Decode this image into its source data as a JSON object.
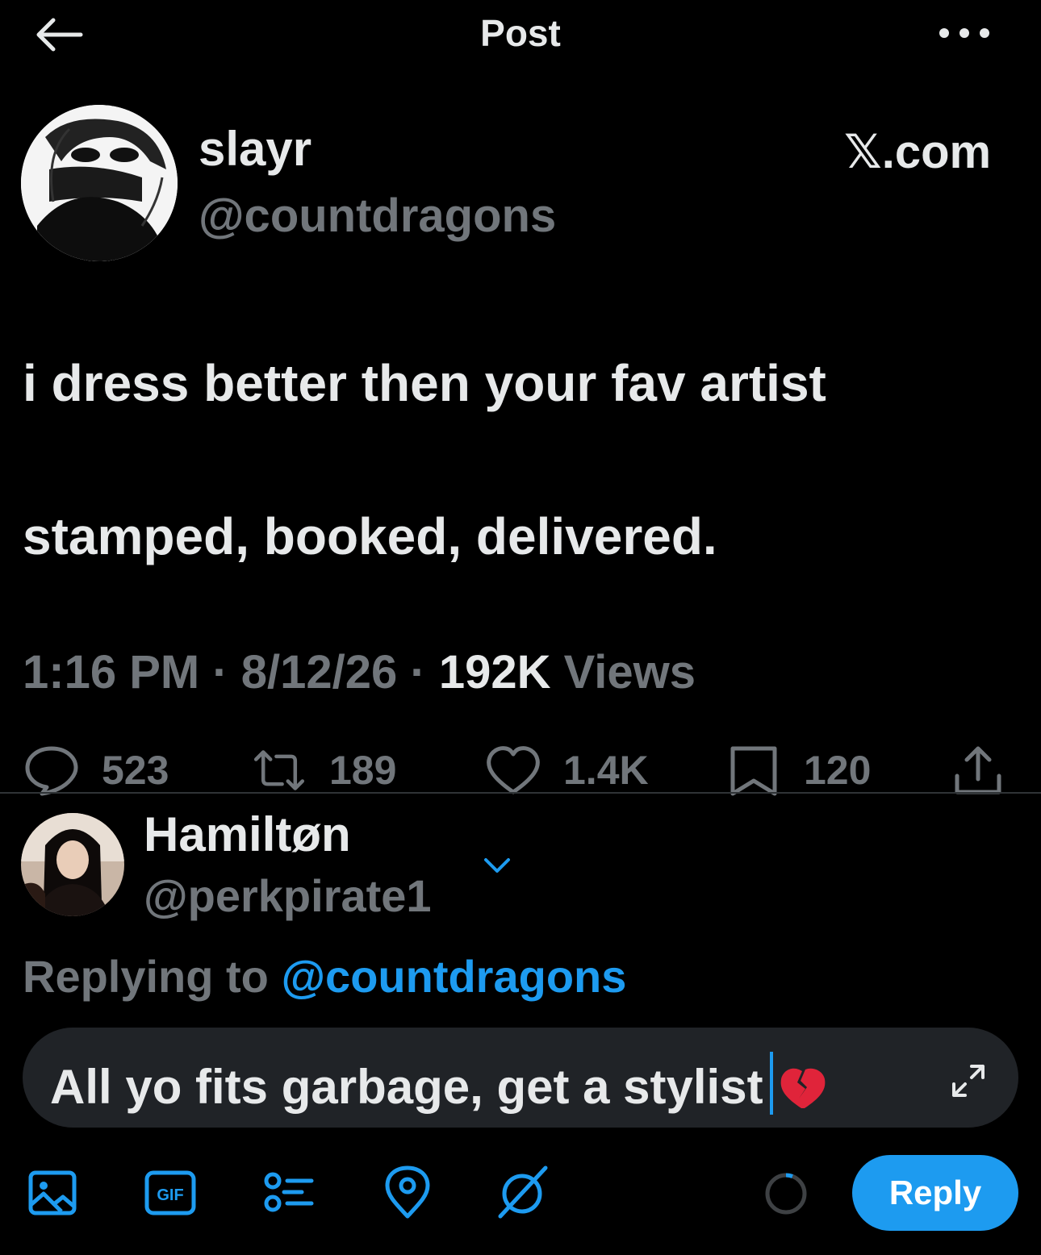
{
  "header": {
    "title": "Post"
  },
  "post": {
    "author": {
      "display_name": "slayr",
      "handle": "@countdragons"
    },
    "source": "𝕏.com",
    "text_lines": [
      "i dress better then your fav artist",
      "stamped, booked, delivered."
    ],
    "meta": {
      "time": "1:16 PM",
      "date": "8/12/26",
      "views_count": "192K",
      "views_label": "Views",
      "separator": "·"
    },
    "actions": {
      "replies": "523",
      "reposts": "189",
      "likes": "1.4K",
      "bookmarks": "120"
    }
  },
  "composer": {
    "user": {
      "display_name": "Hamiltøn",
      "handle": "@perkpirate1"
    },
    "replying_prefix": "Replying to",
    "replying_to": "@countdragons",
    "draft_text": "All yo fits garbage, get a stylist",
    "draft_emoji": "broken-heart",
    "reply_button": "Reply"
  },
  "colors": {
    "background": "#000000",
    "primary_text": "#e7e9ea",
    "secondary_text": "#71767b",
    "accent": "#1d9bf0",
    "composer_bg": "#202327",
    "divider": "#2f3336"
  },
  "icons": {
    "back": "arrow-left-icon",
    "more": "more-dots-icon",
    "reply": "reply-bubble-icon",
    "repost": "repost-icon",
    "like": "heart-icon",
    "bookmark": "bookmark-icon",
    "share": "share-icon",
    "expand": "expand-icon",
    "image": "image-icon",
    "gif": "gif-icon",
    "poll": "poll-icon",
    "location": "location-pin-icon",
    "grok": "grok-icon"
  }
}
